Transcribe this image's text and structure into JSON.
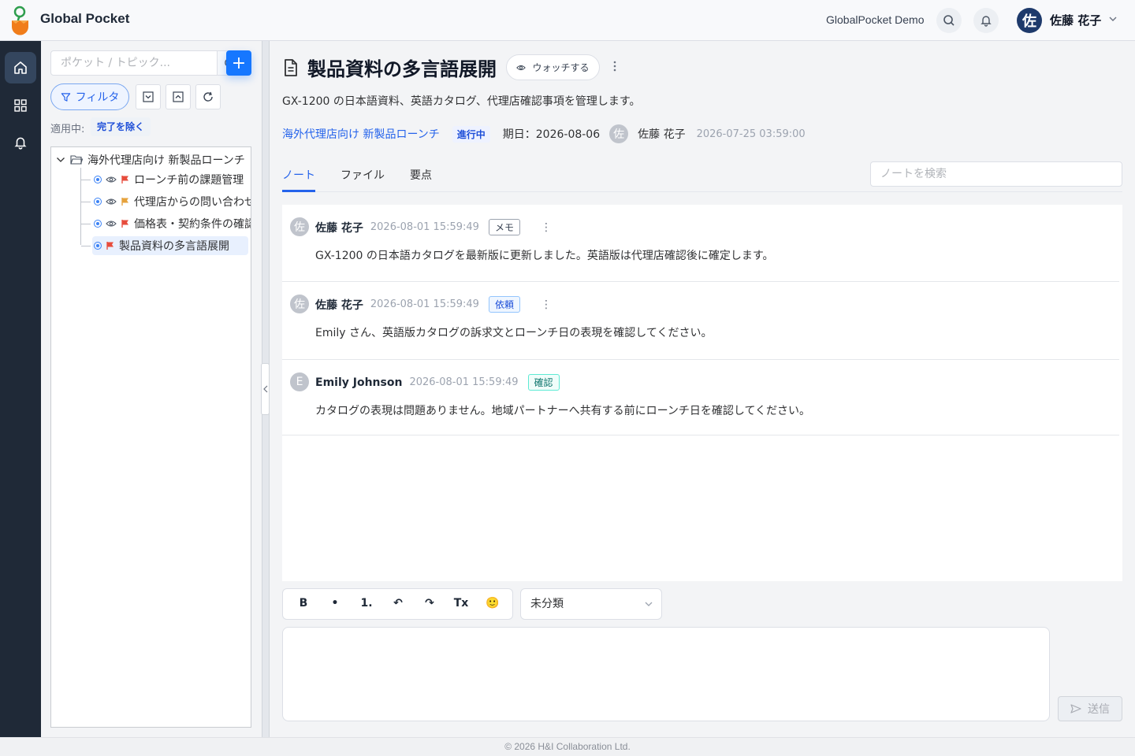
{
  "header": {
    "brand": "Global Pocket",
    "org": "GlobalPocket Demo",
    "user_initial": "佐",
    "user_name": "佐藤 花子"
  },
  "rail": {
    "items": [
      {
        "icon": "home-icon",
        "active": true
      },
      {
        "icon": "grid-icon",
        "active": false
      },
      {
        "icon": "bell-icon",
        "active": false
      }
    ]
  },
  "sidebar": {
    "search_placeholder": "ポケット / トピック...",
    "add_label": "+",
    "filter_label": "フィルタ",
    "applied_label": "適用中:",
    "applied_tag": "完了を除く",
    "tree": {
      "root": "海外代理店向け 新製品ローンチ",
      "items": [
        {
          "label": "ローンチ前の課題管理",
          "flag_color": "#e74c3c",
          "watched": true
        },
        {
          "label": "代理店からの問い合わせ",
          "flag_color": "#e6a23c",
          "watched": true
        },
        {
          "label": "価格表・契約条件の確認",
          "flag_color": "#e74c3c",
          "watched": true
        },
        {
          "label": "製品資料の多言語展開",
          "flag_color": "#e74c3c",
          "watched": false,
          "selected": true
        }
      ]
    }
  },
  "topic": {
    "title": "製品資料の多言語展開",
    "watch_label": "ウォッチする",
    "description": "GX-1200 の日本語資料、英語カタログ、代理店確認事項を管理します。",
    "pocket_link": "海外代理店向け 新製品ローンチ",
    "status": "進行中",
    "due": "期日：2026-08-06",
    "owner_initial": "佐",
    "owner": "佐藤 花子",
    "created": "2026-07-25 03:59:00"
  },
  "tabs": {
    "items": [
      "ノート",
      "ファイル",
      "要点"
    ],
    "active": 0,
    "search_placeholder": "ノートを検索"
  },
  "notes": [
    {
      "initial": "佐",
      "author": "佐藤 花子",
      "time": "2026-08-01 15:59:49",
      "tag": "メモ",
      "body": "GX-1200 の日本語カタログを最新版に更新しました。英語版は代理店確認後に確定します。"
    },
    {
      "initial": "佐",
      "author": "佐藤 花子",
      "time": "2026-08-01 15:59:49",
      "tag": "依頼",
      "body": "Emily さん、英語版カタログの訴求文とローンチ日の表現を確認してください。"
    },
    {
      "initial": "E",
      "author": "Emily Johnson",
      "time": "2026-08-01 15:59:49",
      "tag": "確認",
      "body": "カタログの表現は問題ありません。地域パートナーへ共有する前にローンチ日を確認してください。"
    }
  ],
  "composer": {
    "toolbar": {
      "bold": "B",
      "bullet": "•",
      "numbered": "1.",
      "undo": "↶",
      "redo": "↷",
      "clear": "Tx",
      "emoji": "🙂"
    },
    "category": "未分類",
    "send_label": "送信"
  },
  "footer": {
    "copyright": "© 2026 H&I Collaboration Ltd."
  },
  "colors": {
    "accent": "#1677ff",
    "rail_bg": "#1f2937",
    "link": "#2563eb"
  }
}
